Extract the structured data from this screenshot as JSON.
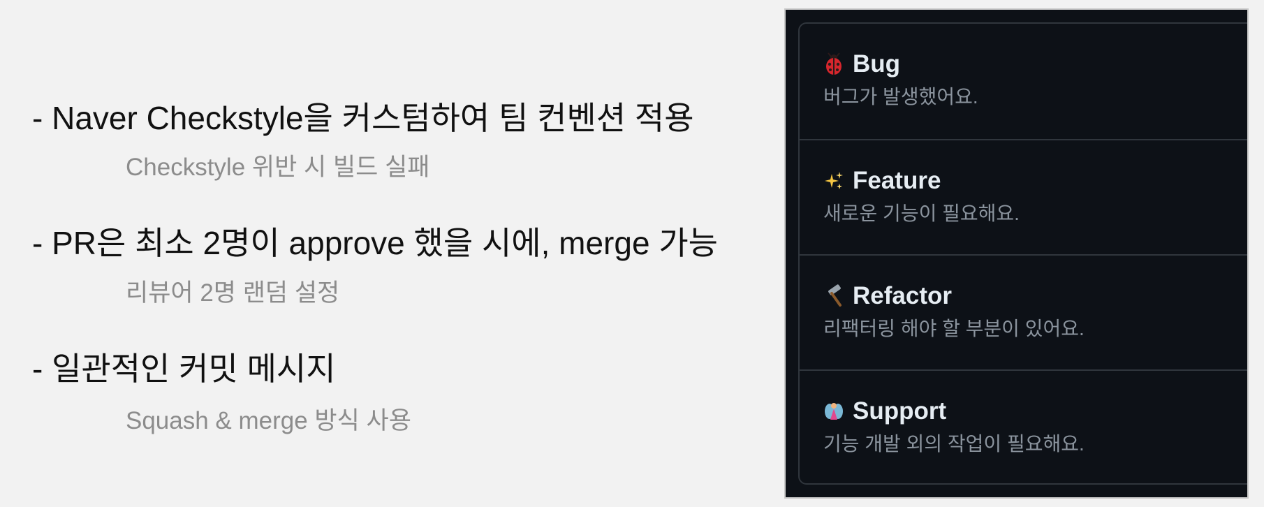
{
  "left_points": [
    {
      "main": "- Naver Checkstyle을 커스텀하여 팀 컨벤션 적용",
      "sub": "Checkstyle 위반 시 빌드 실패"
    },
    {
      "main": "- PR은 최소 2명이 approve 했을 시에, merge 가능",
      "sub": "리뷰어 2명 랜덤 설정"
    },
    {
      "main": "- 일관적인 커밋 메시지",
      "sub": "Squash & merge 방식 사용"
    }
  ],
  "issue_templates": [
    {
      "title": "Bug",
      "description": "버그가 발생했어요.",
      "icon": "ladybug-icon"
    },
    {
      "title": "Feature",
      "description": "새로운 기능이 필요해요.",
      "icon": "sparkles-icon"
    },
    {
      "title": "Refactor",
      "description": "리팩터링 해야 할 부분이 있어요.",
      "icon": "hammer-icon"
    },
    {
      "title": "Support",
      "description": "기능 개발 외의 작업이 필요해요.",
      "icon": "fairy-icon"
    }
  ]
}
